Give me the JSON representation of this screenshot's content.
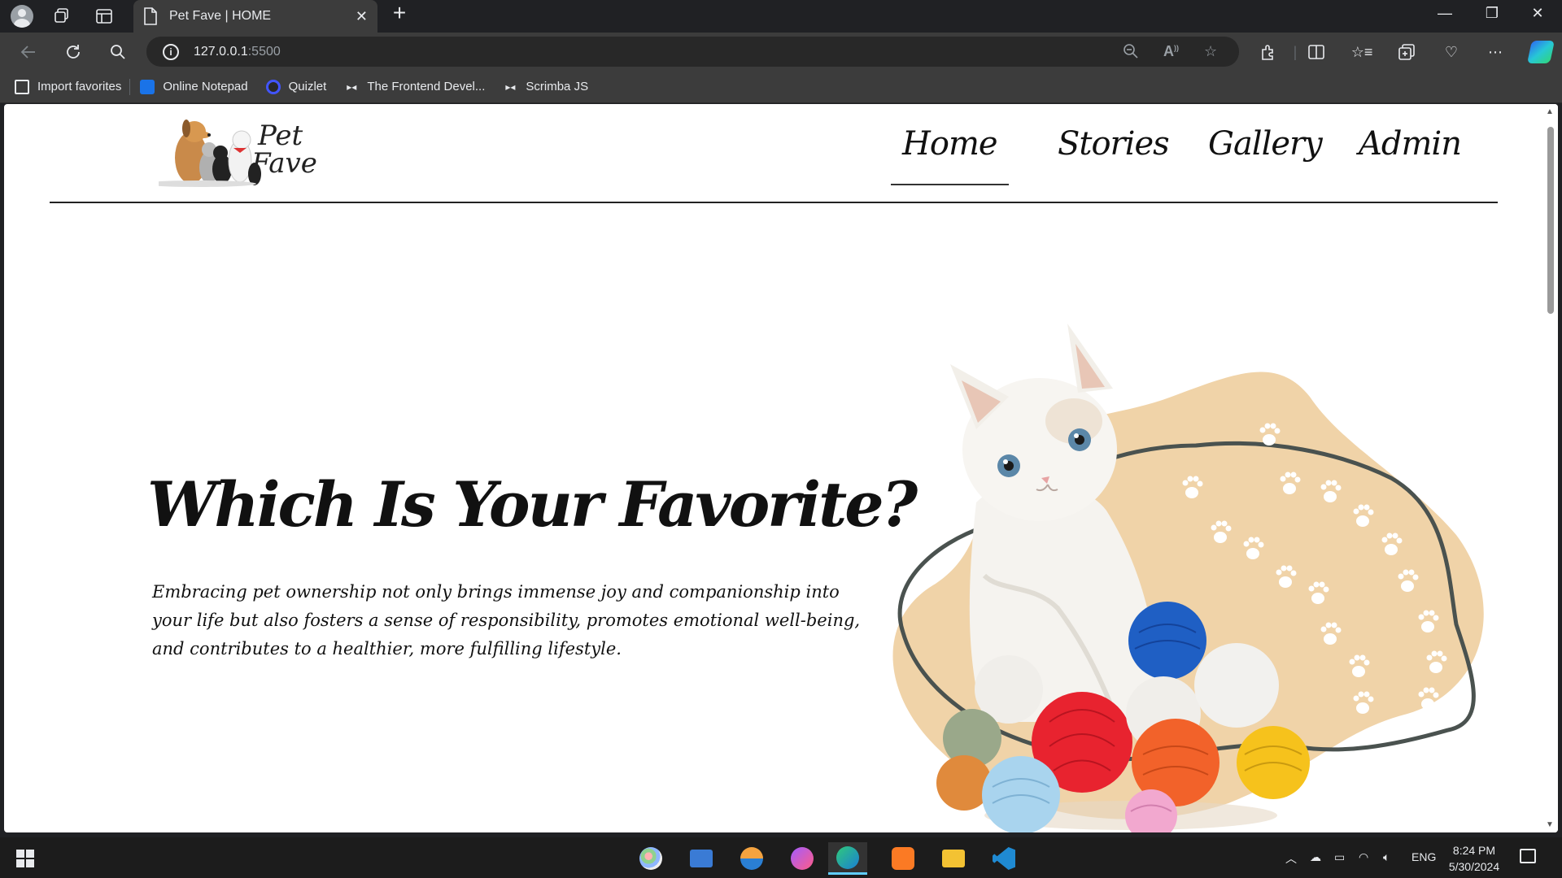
{
  "browser": {
    "tab_title": "Pet Fave | HOME",
    "new_tab_symbol": "+",
    "close_symbol": "✕",
    "address_host": "127.0.0.1",
    "address_port": ":5500",
    "info_symbol": "i",
    "window_controls": [
      "—",
      "❐",
      "✕"
    ]
  },
  "bookmarks": [
    {
      "label": "Import favorites",
      "icon": "import-icon"
    },
    {
      "label": "Online Notepad",
      "icon": "notepad-icon"
    },
    {
      "label": "Quizlet",
      "icon": "quizlet-icon"
    },
    {
      "label": "The Frontend Devel...",
      "icon": "scrimba-icon"
    },
    {
      "label": "Scrimba JS",
      "icon": "scrimba-icon"
    }
  ],
  "site": {
    "logo_line1": "Pet",
    "logo_line2": "Fave",
    "nav": [
      "Home",
      "Stories",
      "Gallery",
      "Admin"
    ],
    "active_nav": "Home",
    "hero_title": "Which Is Your Favorite?",
    "hero_text": "Embracing pet ownership not only brings immense joy and companionship into your life but also fosters a sense of responsibility, promotes emotional well-being, and contributes to a healthier, more fulfilling lifestyle."
  },
  "taskbar": {
    "language": "ENG",
    "time": "8:24 PM",
    "date": "5/30/2024",
    "apps": [
      "paint-icon",
      "remote-desktop-icon",
      "toolbox-icon",
      "messenger-icon",
      "edge-icon",
      "xampp-icon",
      "file-explorer-icon",
      "vscode-icon"
    ]
  },
  "colors": {
    "blob": "#f0d3a8",
    "outline": "#4a524f",
    "accent": "#60cdff"
  }
}
